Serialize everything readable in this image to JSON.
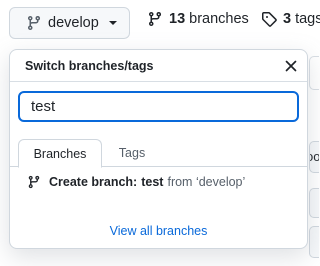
{
  "topbar": {
    "branch_button": {
      "label": "develop",
      "icon": "git-branch-icon"
    },
    "branches_stat": {
      "count": "13",
      "label": "branches",
      "icon": "git-branch-icon"
    },
    "tags_stat": {
      "count": "3",
      "label": "tags",
      "icon": "tag-icon"
    }
  },
  "dropdown": {
    "title": "Switch branches/tags",
    "close_icon": "x-icon",
    "filter": {
      "value": "test"
    },
    "tabs": [
      {
        "label": "Branches",
        "selected": true
      },
      {
        "label": "Tags",
        "selected": false
      }
    ],
    "create_branch": {
      "prefix": "Create branch:",
      "name": "test",
      "suffix": "from ‘develop’",
      "icon": "git-branch-icon"
    },
    "view_all_link": "View all branches"
  },
  "background": {
    "partial_text": "oo"
  },
  "colors": {
    "accent": "#0969da",
    "border": "#d0d7de",
    "text": "#1f2328",
    "muted": "#57606a"
  }
}
